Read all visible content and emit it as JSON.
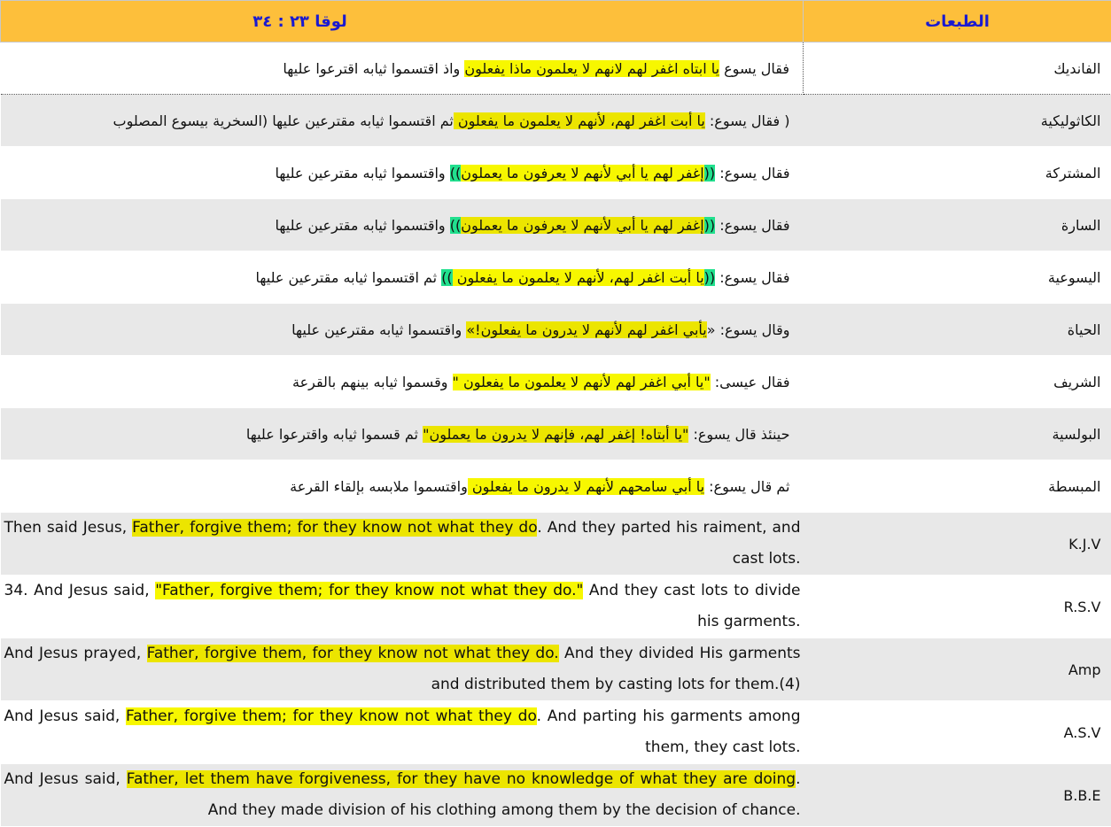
{
  "header": {
    "verse_ref": "لوقا ٢٣ : ٣٤",
    "editions_label": "الطبعات"
  },
  "colors": {
    "header_bg": "#fdbf3b",
    "header_text": "#1a1ad0",
    "highlight_yellow": "#f7f700",
    "highlight_green": "#21e08e",
    "row_gray": "#e8e8e8"
  },
  "rows": [
    {
      "edition": "الفانديك",
      "a": "فقال يسوع ",
      "h": "يا ابتاه اغفر لهم لانهم لا يعلمون ماذا يفعلون",
      "b": " واذ اقتسموا ثيابه اقترعوا عليها"
    },
    {
      "edition": "الكاثوليكية",
      "a": "( فقال يسوع: ",
      "h": "يا أبت اغفر لهم، لأنهم لا يعلمون ما يفعلون ",
      "b": "  ثم اقتسموا ثيابه مقترعين عليها  (السخرية بيسوع المصلوب"
    },
    {
      "edition": "المشتركة",
      "a": "فقال يسوع: ",
      "g1": "((",
      "h": "إغفر لهم يا أبي  لأنهم لا يعرفون ما يعملون",
      "g2": "))",
      "b": "  واقتسموا ثيابه مقترعين عليها"
    },
    {
      "edition": "السارة",
      "a": "فقال يسوع: ",
      "g1": "((",
      "h": "إغفر لهم يا أبي  لأنهم لا يعرفون ما يعملون",
      "g2": "))",
      "b": "  واقتسموا ثيابه مقترعين عليها"
    },
    {
      "edition": "اليسوعية",
      "a": "فقال يسوع: ",
      "g1": "((",
      "h": "يا أبت اغفر لهم، لأنهم لا يعلمون ما يفعلون ",
      "g2": "))",
      "b": "  ثم اقتسموا ثيابه مقترعين عليها"
    },
    {
      "edition": "الحياة",
      "a": "وقال يسوع: «",
      "h": "يأبي  اغفر لهم  لأنهم لا يدرون ما يفعلون!»",
      "b": " واقتسموا ثيابه مقترعين عليها"
    },
    {
      "edition": "الشريف",
      "a": "فقال عيسى: ",
      "h": "\"يا أبي  اغفر لهم لأنهم لا يعلمون ما يفعلون \"",
      "b": " وقسموا ثيابه بينهم بالقرعة"
    },
    {
      "edition": "البولسية",
      "a": "حينئذ قال يسوع: ",
      "h": "\"يا أبتاه! إغفر لهم، فإنهم لا يدرون ما يعملون\"",
      "b": " ثم قسموا ثيابه واقترعوا عليها"
    },
    {
      "edition": "المبسطة",
      "a": "ثم قال يسوع: ",
      "h": "يا أبي  سامحهم لأنهم لا يدرون ما يفعلون ",
      "b": "  واقتسموا ملابسه بإلقاء القرعة"
    }
  ],
  "english_rows": [
    {
      "edition": "K.J.V",
      "a": "Then said Jesus, ",
      "h": "Father, forgive them; for they know not what they do",
      "b": ". And they parted his raiment, and cast lots."
    },
    {
      "edition": "R.S.V",
      "a": "34. And Jesus said, ",
      "h": "\"Father, forgive them; for they know not what they do.\"",
      "b": " And they cast lots to divide his garments."
    },
    {
      "edition": "Amp",
      "a": "And Jesus prayed, ",
      "h": "Father, forgive them, for they know not what they do.",
      "b": " And they divided His garments and distributed them by casting lots for them.(4)"
    },
    {
      "edition": "A.S.V",
      "a": "And Jesus said, ",
      "h": "Father, forgive them; for they know not what they do",
      "b": ". And parting his garments among them, they cast lots."
    },
    {
      "edition": "B.B.E",
      "a": "And Jesus said, ",
      "h": "Father, let them have forgiveness, for they have no knowledge of what they are doing",
      "b": ". And they made division of his clothing among them by the decision of chance."
    }
  ]
}
